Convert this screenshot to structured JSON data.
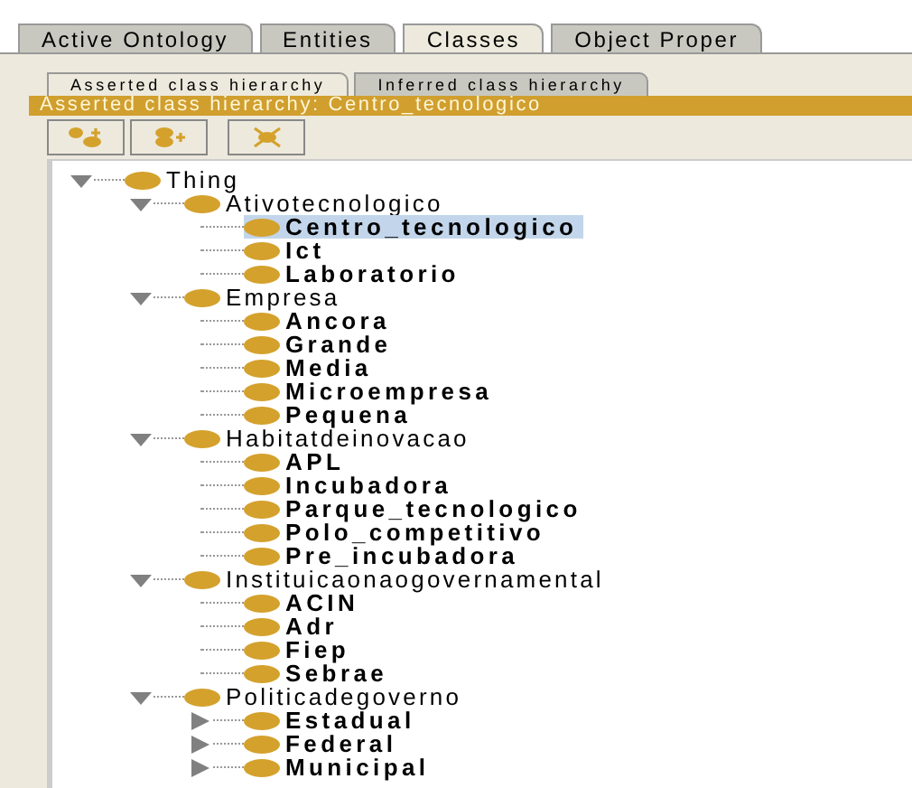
{
  "tabs": [
    {
      "label": "Active Ontology",
      "selected": false
    },
    {
      "label": "Entities",
      "selected": false
    },
    {
      "label": "Classes",
      "selected": true
    },
    {
      "label": "Object Proper",
      "selected": false
    }
  ],
  "subtabs": [
    {
      "label": "Asserted class hierarchy",
      "selected": true
    },
    {
      "label": "Inferred class hierarchy",
      "selected": false
    }
  ],
  "header": "Asserted class hierarchy: Centro_tecnologico",
  "toolbar": [
    {
      "kind": "add-sub"
    },
    {
      "kind": "add-sibling"
    },
    {
      "kind": "delete"
    }
  ],
  "tree": [
    {
      "name": "Thing",
      "bold": false,
      "expanded": true,
      "selected": false,
      "children": [
        {
          "name": "Ativotecnologico",
          "bold": false,
          "expanded": true,
          "selected": false,
          "children": [
            {
              "name": "Centro_tecnologico",
              "bold": true,
              "selected": true
            },
            {
              "name": "Ict",
              "bold": true,
              "selected": false
            },
            {
              "name": "Laboratorio",
              "bold": true,
              "selected": false
            }
          ]
        },
        {
          "name": "Empresa",
          "bold": false,
          "expanded": true,
          "selected": false,
          "children": [
            {
              "name": "Ancora",
              "bold": true,
              "selected": false
            },
            {
              "name": "Grande",
              "bold": true,
              "selected": false
            },
            {
              "name": "Media",
              "bold": true,
              "selected": false
            },
            {
              "name": "Microempresa",
              "bold": true,
              "selected": false
            },
            {
              "name": "Pequena",
              "bold": true,
              "selected": false
            }
          ]
        },
        {
          "name": "Habitatdeinovacao",
          "bold": false,
          "expanded": true,
          "selected": false,
          "children": [
            {
              "name": "APL",
              "bold": true,
              "selected": false
            },
            {
              "name": "Incubadora",
              "bold": true,
              "selected": false
            },
            {
              "name": "Parque_tecnologico",
              "bold": true,
              "selected": false
            },
            {
              "name": "Polo_competitivo",
              "bold": true,
              "selected": false
            },
            {
              "name": "Pre_incubadora",
              "bold": true,
              "selected": false
            }
          ]
        },
        {
          "name": "Instituicaonaogovernamental",
          "bold": false,
          "expanded": true,
          "selected": false,
          "children": [
            {
              "name": "ACIN",
              "bold": true,
              "selected": false
            },
            {
              "name": "Adr",
              "bold": true,
              "selected": false
            },
            {
              "name": "Fiep",
              "bold": true,
              "selected": false
            },
            {
              "name": "Sebrae",
              "bold": true,
              "selected": false
            }
          ]
        },
        {
          "name": "Politicadegoverno",
          "bold": false,
          "expanded": true,
          "selected": false,
          "children": [
            {
              "name": "Estadual",
              "bold": true,
              "expanded": false,
              "selected": false
            },
            {
              "name": "Federal",
              "bold": true,
              "expanded": false,
              "selected": false
            },
            {
              "name": "Municipal",
              "bold": true,
              "expanded": false,
              "selected": false
            }
          ]
        }
      ]
    }
  ]
}
